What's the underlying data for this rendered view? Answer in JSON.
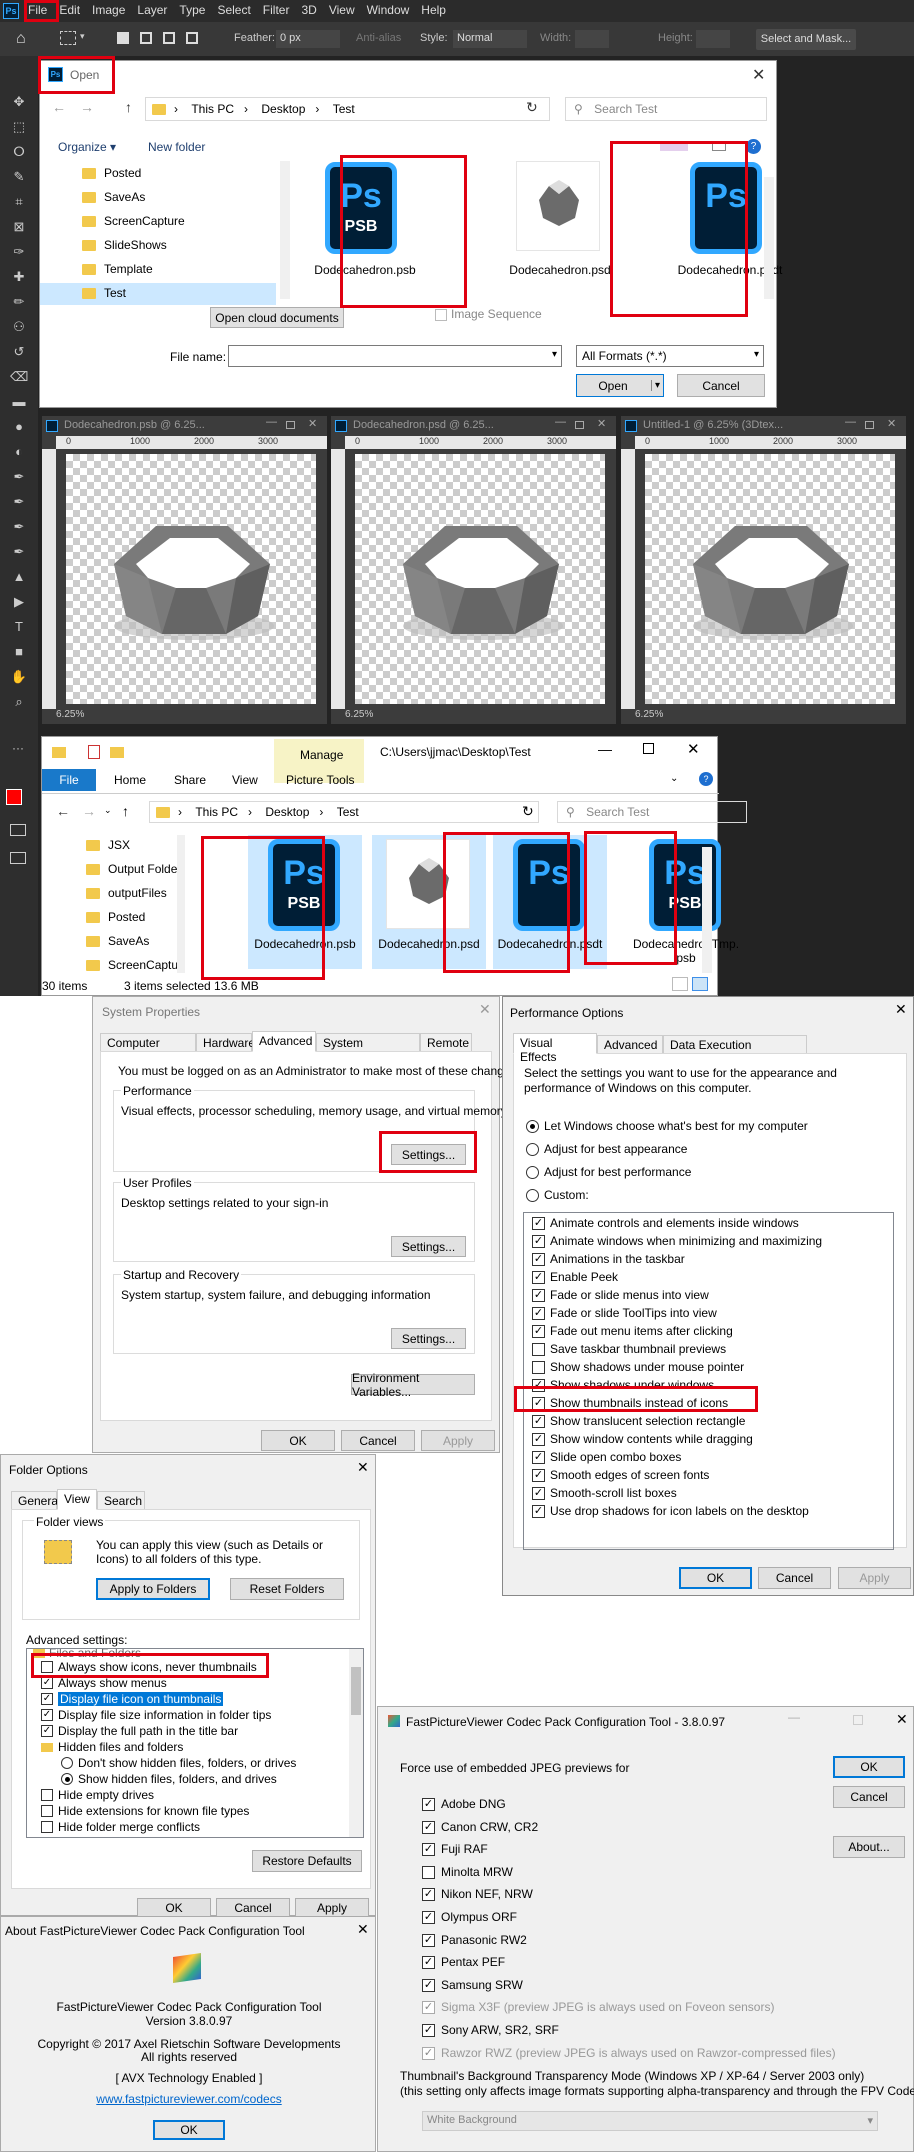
{
  "photoshop": {
    "menu": [
      "File",
      "Edit",
      "Image",
      "Layer",
      "Type",
      "Select",
      "Filter",
      "3D",
      "View",
      "Window",
      "Help"
    ],
    "options": {
      "feather_label": "Feather:",
      "feather_value": "0 px",
      "antialias": "Anti-alias",
      "style_label": "Style:",
      "style_value": "Normal",
      "width_label": "Width:",
      "height_label": "Height:",
      "select_mask": "Select and Mask..."
    },
    "doc_windows": [
      {
        "title": "Dodecahedron.psb @ 6.25...",
        "zoom": "6.25%"
      },
      {
        "title": "Dodecahedron.psd @ 6.25...",
        "zoom": "6.25%"
      },
      {
        "title": "Untitled-1 @ 6.25% (3Dtex...",
        "zoom": "6.25%"
      }
    ],
    "ruler_ticks": [
      "0",
      "1000",
      "2000",
      "3000"
    ]
  },
  "open_dialog": {
    "title": "Open",
    "breadcrumb": [
      "This PC",
      "Desktop",
      "Test"
    ],
    "search_placeholder": "Search Test",
    "organize": "Organize ▾",
    "new_folder": "New folder",
    "folders": [
      "Posted",
      "SaveAs",
      "ScreenCapture",
      "SlideShows",
      "Template",
      "Test"
    ],
    "files": [
      {
        "name": "Dodecahedron.psb",
        "ext": "PSB"
      },
      {
        "name": "Dodecahedron.psd",
        "ext": ""
      },
      {
        "name": "Dodecahedron.psdt",
        "ext": ""
      }
    ],
    "open_cloud": "Open cloud documents",
    "image_sequence": "Image Sequence",
    "filename_label": "File name:",
    "format": "All Formats (*.*)",
    "open_btn": "Open",
    "cancel_btn": "Cancel"
  },
  "explorer": {
    "path": "C:\\Users\\jjmac\\Desktop\\Test",
    "manage": "Manage",
    "ribbon_tabs": [
      "File",
      "Home",
      "Share",
      "View",
      "Picture Tools"
    ],
    "breadcrumb": [
      "This PC",
      "Desktop",
      "Test"
    ],
    "search_placeholder": "Search Test",
    "folders": [
      "JSX",
      "Output Folde",
      "outputFiles",
      "Posted",
      "SaveAs",
      "ScreenCaptur"
    ],
    "files": [
      {
        "name": "Dodecahedron.psb",
        "ext": "PSB"
      },
      {
        "name": "Dodecahedron.psd",
        "ext": ""
      },
      {
        "name": "Dodecahedron.psdt",
        "ext": ""
      },
      {
        "name": "DodecahedronTmp.psb",
        "ext": "PSB"
      }
    ],
    "status_items": "30 items",
    "status_selected": "3 items selected  13.6 MB"
  },
  "system_properties": {
    "title": "System Properties",
    "tabs": [
      "Computer Name",
      "Hardware",
      "Advanced",
      "System Protection",
      "Remote"
    ],
    "admin_note": "You must be logged on as an Administrator to make most of these changes.",
    "perf_title": "Performance",
    "perf_desc": "Visual effects, processor scheduling, memory usage, and virtual memory",
    "profiles_title": "User Profiles",
    "profiles_desc": "Desktop settings related to your sign-in",
    "startup_title": "Startup and Recovery",
    "startup_desc": "System startup, system failure, and debugging information",
    "settings": "Settings...",
    "env": "Environment Variables...",
    "ok": "OK",
    "cancel": "Cancel",
    "apply": "Apply"
  },
  "performance_options": {
    "title": "Performance Options",
    "tabs": [
      "Visual Effects",
      "Advanced",
      "Data Execution Prevention"
    ],
    "desc": "Select the settings you want to use for the appearance and performance of Windows on this computer.",
    "radios": [
      "Let Windows choose what's best for my computer",
      "Adjust for best appearance",
      "Adjust for best performance",
      "Custom:"
    ],
    "effects": [
      {
        "label": "Animate controls and elements inside windows",
        "checked": true
      },
      {
        "label": "Animate windows when minimizing and maximizing",
        "checked": true
      },
      {
        "label": "Animations in the taskbar",
        "checked": true
      },
      {
        "label": "Enable Peek",
        "checked": true
      },
      {
        "label": "Fade or slide menus into view",
        "checked": true
      },
      {
        "label": "Fade or slide ToolTips into view",
        "checked": true
      },
      {
        "label": "Fade out menu items after clicking",
        "checked": true
      },
      {
        "label": "Save taskbar thumbnail previews",
        "checked": false
      },
      {
        "label": "Show shadows under mouse pointer",
        "checked": false
      },
      {
        "label": "Show shadows under windows",
        "checked": true
      },
      {
        "label": "Show thumbnails instead of icons",
        "checked": true
      },
      {
        "label": "Show translucent selection rectangle",
        "checked": true
      },
      {
        "label": "Show window contents while dragging",
        "checked": true
      },
      {
        "label": "Slide open combo boxes",
        "checked": true
      },
      {
        "label": "Smooth edges of screen fonts",
        "checked": true
      },
      {
        "label": "Smooth-scroll list boxes",
        "checked": true
      },
      {
        "label": "Use drop shadows for icon labels on the desktop",
        "checked": true
      }
    ],
    "ok": "OK",
    "cancel": "Cancel",
    "apply": "Apply"
  },
  "folder_options": {
    "title": "Folder Options",
    "tabs": [
      "General",
      "View",
      "Search"
    ],
    "views_title": "Folder views",
    "views_desc": "You can apply this view (such as Details or Icons) to all folders of this type.",
    "apply_folders": "Apply to Folders",
    "reset_folders": "Reset Folders",
    "adv_label": "Advanced settings:",
    "tree_root": "Files and Folders",
    "items": [
      {
        "label": "Always show icons, never thumbnails",
        "type": "check",
        "checked": false
      },
      {
        "label": "Always show menus",
        "type": "check",
        "checked": true
      },
      {
        "label": "Display file icon on thumbnails",
        "type": "check",
        "checked": true
      },
      {
        "label": "Display file size information in folder tips",
        "type": "check",
        "checked": true
      },
      {
        "label": "Display the full path in the title bar",
        "type": "check",
        "checked": true
      },
      {
        "label": "Hidden files and folders",
        "type": "folder",
        "checked": false
      },
      {
        "label": "Don't show hidden files, folders, or drives",
        "type": "radio",
        "checked": false
      },
      {
        "label": "Show hidden files, folders, and drives",
        "type": "radio",
        "checked": true
      },
      {
        "label": "Hide empty drives",
        "type": "check",
        "checked": false
      },
      {
        "label": "Hide extensions for known file types",
        "type": "check",
        "checked": false
      },
      {
        "label": "Hide folder merge conflicts",
        "type": "check",
        "checked": false
      }
    ],
    "restore": "Restore Defaults",
    "ok": "OK",
    "cancel": "Cancel",
    "apply": "Apply"
  },
  "fpv": {
    "title": "FastPictureViewer Codec Pack Configuration Tool - 3.8.0.97",
    "force_label": "Force use of embedded JPEG previews for",
    "formats": [
      {
        "label": "Adobe DNG",
        "checked": true,
        "disabled": false
      },
      {
        "label": "Canon CRW, CR2",
        "checked": true,
        "disabled": false
      },
      {
        "label": "Fuji RAF",
        "checked": true,
        "disabled": false
      },
      {
        "label": "Minolta MRW",
        "checked": false,
        "disabled": false
      },
      {
        "label": "Nikon NEF, NRW",
        "checked": true,
        "disabled": false
      },
      {
        "label": "Olympus ORF",
        "checked": true,
        "disabled": false
      },
      {
        "label": "Panasonic RW2",
        "checked": true,
        "disabled": false
      },
      {
        "label": "Pentax PEF",
        "checked": true,
        "disabled": false
      },
      {
        "label": "Samsung SRW",
        "checked": true,
        "disabled": false
      },
      {
        "label": "Sigma X3F (preview JPEG is always used on Foveon sensors)",
        "checked": true,
        "disabled": true
      },
      {
        "label": "Sony ARW, SR2, SRF",
        "checked": true,
        "disabled": false
      },
      {
        "label": "Rawzor RWZ (preview JPEG is always used on Rawzor-compressed files)",
        "checked": true,
        "disabled": true
      }
    ],
    "bg_line1": "Thumbnail's Background Transparency Mode (Windows XP / XP-64 / Server 2003 only)",
    "bg_line2": "(this setting only affects image formats supporting alpha-transparency and through the FPV Codec Pack)",
    "bg_value": "White Background",
    "ok": "OK",
    "cancel": "Cancel",
    "about": "About..."
  },
  "about": {
    "title": "About FastPictureViewer Codec Pack Configuration Tool",
    "name": "FastPictureViewer Codec Pack Configuration Tool",
    "version": "Version 3.8.0.97",
    "copyright": "Copyright © 2017 Axel Rietschin Software Developments",
    "rights": "All rights reserved",
    "avx": "[ AVX Technology Enabled ]",
    "link": "www.fastpictureviewer.com/codecs",
    "ok": "OK"
  }
}
